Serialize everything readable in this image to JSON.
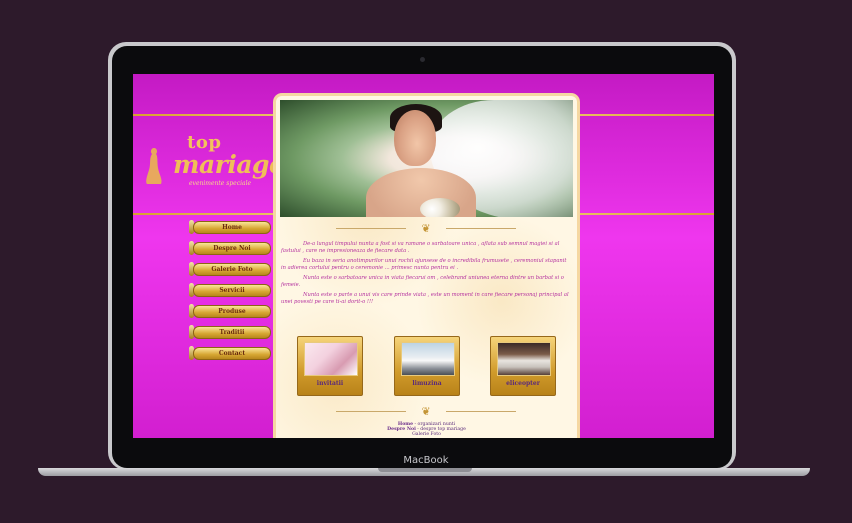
{
  "device": {
    "brand_label": "MacBook"
  },
  "site": {
    "logo": {
      "top": "top",
      "mariage": "mariage",
      "tagline": "evenimente speciale"
    },
    "nav": [
      {
        "label": "Home"
      },
      {
        "label": "Despre Noi"
      },
      {
        "label": "Galerie Foto"
      },
      {
        "label": "Servicii"
      },
      {
        "label": "Produse"
      },
      {
        "label": "Traditii"
      },
      {
        "label": "Contact"
      }
    ],
    "paragraphs": [
      "De-a lungul timpului nunta a fost si va ramane o sarbatoare unica , aflata sub semnul magiei si al fastului , care ne impresioneaza de fiecare data .",
      "Eu baza in seria anotimpurilor unui rochii ajunsese de o incredibila frumusete , ceremoniul stapanit in adierea cortului pentru o ceremonie ... primesc nunta pentru ei .",
      "Nunta este o sarbatoare unica in viata fiecarui om , celebrand uniunea eterna dintre un barbat si o femeie.",
      "Nunta este o parte a unui vis care prinde viata , este un moment in care fiecare personaj principal al unei povesti pe care ti-ai dorit-o !!!"
    ],
    "thumbs": [
      {
        "caption": "invitatii"
      },
      {
        "caption": "limuzina"
      },
      {
        "caption": "eliceopter"
      }
    ],
    "footer": {
      "line1_bold": "Home",
      "line1_rest": " - organizari nunti",
      "line2_bold": "Despre Noi",
      "line2_rest": " - despre top mariage",
      "line3": "Galerie Foto"
    }
  },
  "colors": {
    "magenta_bg": "#e033e0",
    "gold": "#d6a632",
    "cream": "#fff7e4",
    "text_pink": "#b4319f"
  }
}
